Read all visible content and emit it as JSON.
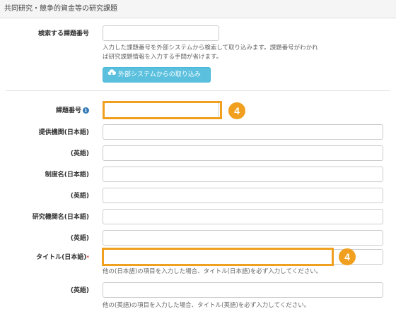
{
  "section": {
    "title": "共同研究・競争的資金等の研究課題"
  },
  "search": {
    "label": "検索する課題番号",
    "value": "",
    "help_line1": "入力した課題番号を外部システムから検索して取り込みます。課題番号がわかれ",
    "help_line2": "ば研究課題情報を入力する手間が省けます。",
    "import_button": "外部システムからの取り込み",
    "import_icon": "cloud-download-icon"
  },
  "form": {
    "task_number": {
      "label": "課題番号",
      "icon": "info-icon",
      "value": ""
    },
    "provider_ja": {
      "label": "提供機関(日本語)",
      "value": ""
    },
    "provider_en": {
      "label": "(英語)",
      "value": ""
    },
    "system_ja": {
      "label": "制度名(日本語)",
      "value": ""
    },
    "system_en": {
      "label": "(英語)",
      "value": ""
    },
    "org_ja": {
      "label": "研究機関名(日本語)",
      "value": ""
    },
    "org_en": {
      "label": "(英語)",
      "value": ""
    },
    "title_ja": {
      "label": "タイトル(日本語)",
      "required_mark": "*",
      "value": "",
      "help": "他の(日本語)の項目を入力した場合、タイトル(日本語)を必ず入力してください。"
    },
    "title_en": {
      "label": "(英語)",
      "value": "",
      "help": "他の(英語)の項目を入力した場合、タイトル(英語)を必ず入力してください。"
    }
  },
  "callouts": {
    "badge1": "4",
    "badge2": "4",
    "highlight_color": "#f0a01e"
  }
}
